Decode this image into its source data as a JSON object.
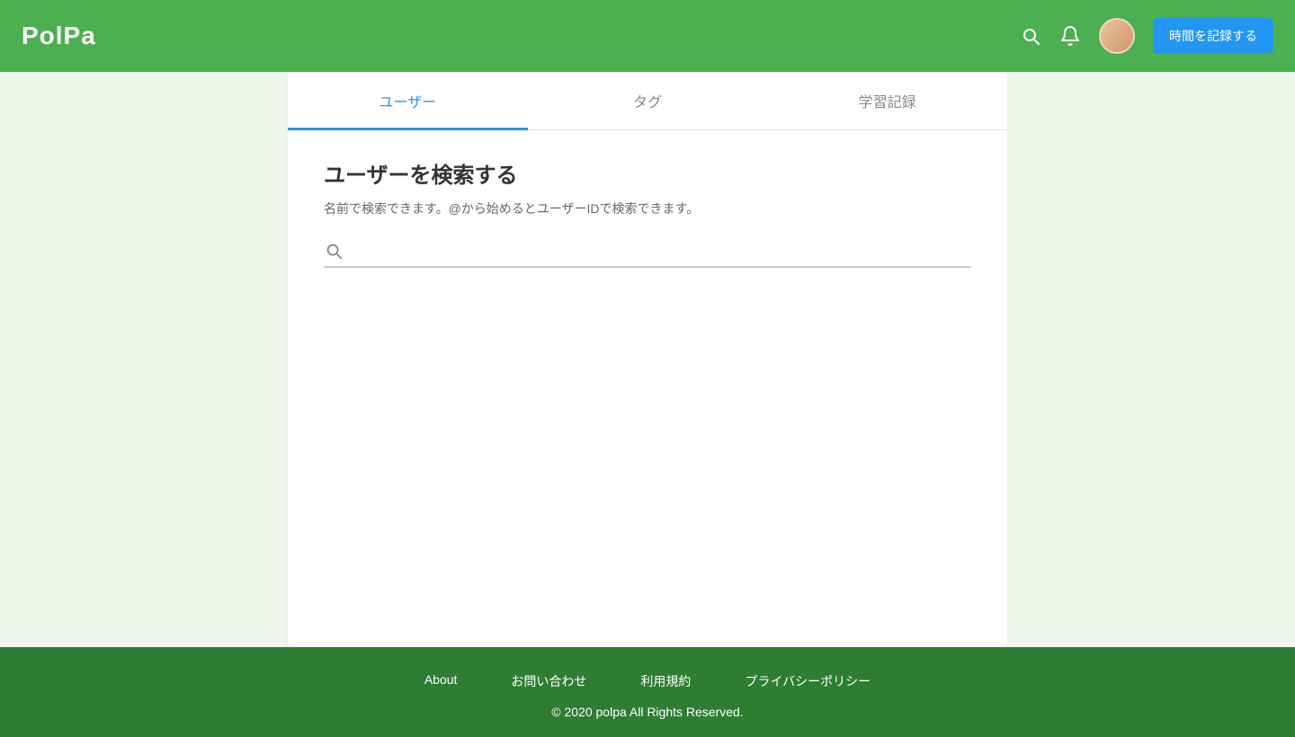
{
  "header": {
    "logo": "PolPa",
    "record_button_label": "時間を記録する"
  },
  "tabs": [
    {
      "id": "users",
      "label": "ユーザー",
      "active": true
    },
    {
      "id": "tags",
      "label": "タグ",
      "active": false
    },
    {
      "id": "study",
      "label": "学習記録",
      "active": false
    }
  ],
  "search": {
    "title": "ユーザーを検索する",
    "description": "名前で検索できます。@から始めるとユーザーIDで検索できます。",
    "placeholder": ""
  },
  "footer": {
    "links": [
      {
        "label": "About"
      },
      {
        "label": "お問い合わせ"
      },
      {
        "label": "利用規約"
      },
      {
        "label": "プライバシーポリシー"
      }
    ],
    "copyright": "© 2020 polpa All Rights Reserved."
  }
}
